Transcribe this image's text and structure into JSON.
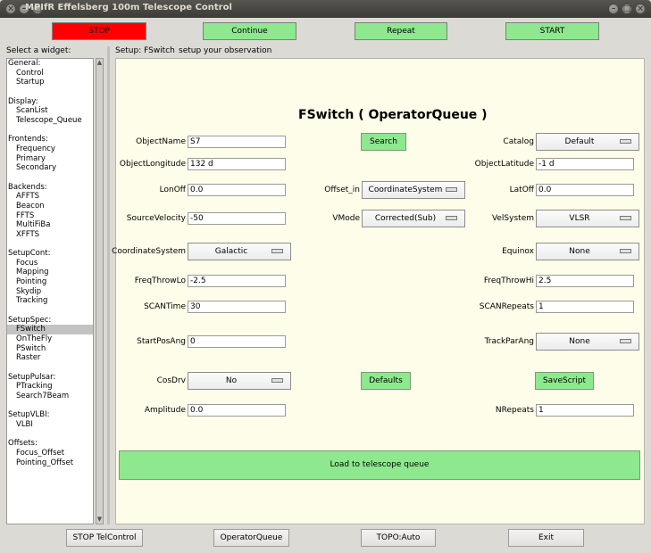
{
  "window": {
    "title": "MPIfR Effelsberg 100m Telescope Control"
  },
  "topbar": {
    "stop": "STOP",
    "continue": "Continue",
    "repeat": "Repeat",
    "start": "START"
  },
  "left": {
    "header": "Select a widget:",
    "groups": [
      {
        "label": "General:",
        "items": [
          "Control",
          "Startup"
        ]
      },
      {
        "label": "Display:",
        "items": [
          "ScanList",
          "Telescope_Queue"
        ]
      },
      {
        "label": "Frontends:",
        "items": [
          "Frequency",
          "Primary",
          "Secondary"
        ]
      },
      {
        "label": "Backends:",
        "items": [
          "AFFTS",
          "Beacon",
          "FFTS",
          "MultiFiBa",
          "XFFTS"
        ]
      },
      {
        "label": "SetupCont:",
        "items": [
          "Focus",
          "Mapping",
          "Pointing",
          "Skydip",
          "Tracking"
        ]
      },
      {
        "label": "SetupSpec:",
        "items": [
          "FSwitch",
          "OnTheFly",
          "PSwitch",
          "Raster"
        ]
      },
      {
        "label": "SetupPulsar:",
        "items": [
          "PTracking",
          "Search7Beam"
        ]
      },
      {
        "label": "SetupVLBI:",
        "items": [
          "VLBI"
        ]
      },
      {
        "label": "Offsets:",
        "items": [
          "Focus_Offset",
          "Pointing_Offset"
        ]
      }
    ],
    "selected": "FSwitch"
  },
  "setup": {
    "header": "Setup: FSwitch",
    "subheader": "setup your observation"
  },
  "form": {
    "title": "FSwitch ( OperatorQueue )",
    "object_name_label": "ObjectName",
    "object_name_value": "S7",
    "search_button": "Search",
    "catalog_label": "Catalog",
    "catalog_value": "Default",
    "object_longitude_label": "ObjectLongitude",
    "object_longitude_value": "132 d",
    "object_latitude_label": "ObjectLatitude",
    "object_latitude_value": "-1 d",
    "lonoff_label": "LonOff",
    "lonoff_value": "0.0",
    "offset_in_label": "Offset_in",
    "offset_in_value": "CoordinateSystem",
    "latoff_label": "LatOff",
    "latoff_value": "0.0",
    "source_velocity_label": "SourceVelocity",
    "source_velocity_value": "-50",
    "vmode_label": "VMode",
    "vmode_value": "Corrected(Sub)",
    "velsystem_label": "VelSystem",
    "velsystem_value": "VLSR",
    "coordinate_system_label": "CoordinateSystem",
    "coordinate_system_value": "Galactic",
    "equinox_label": "Equinox",
    "equinox_value": "None",
    "freqthrowlo_label": "FreqThrowLo",
    "freqthrowlo_value": "-2.5",
    "freqthrowhi_label": "FreqThrowHi",
    "freqthrowhi_value": "2.5",
    "scantime_label": "SCANTime",
    "scantime_value": "30",
    "scanrepeats_label": "SCANRepeats",
    "scanrepeats_value": "1",
    "startposang_label": "StartPosAng",
    "startposang_value": "0",
    "trackparang_label": "TrackParAng",
    "trackparang_value": "None",
    "cosdrv_label": "CosDrv",
    "cosdrv_value": "No",
    "defaults_button": "Defaults",
    "savescript_button": "SaveScript",
    "amplitude_label": "Amplitude",
    "amplitude_value": "0.0",
    "nrepeats_label": "NRepeats",
    "nrepeats_value": "1",
    "load_button": "Load to telescope queue"
  },
  "bottom": {
    "stop_tel": "STOP TelControl",
    "operator_queue": "OperatorQueue",
    "topo": "TOPO:Auto",
    "exit": "Exit"
  },
  "colors": {
    "stop": "#ff0000",
    "green": "#8ee88e",
    "panel": "#fdfde9"
  }
}
